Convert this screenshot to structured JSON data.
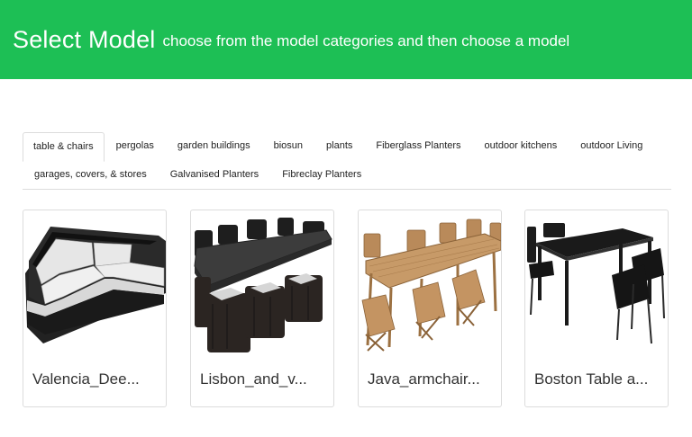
{
  "header": {
    "title": "Select Model",
    "subtitle": "choose from the model categories and then choose a model"
  },
  "tabs": {
    "active": "table & chairs",
    "row1": [
      "table & chairs",
      "pergolas",
      "garden buildings",
      "biosun",
      "plants",
      "Fiberglass Planters",
      "outdoor kitchens",
      "outdoor Living"
    ],
    "row2": [
      "garages, covers, & stores",
      "Galvanised Planters",
      "Fibreclay Planters"
    ]
  },
  "models": [
    {
      "label": "Valencia_Dee...",
      "icon": "corner-sofa-image"
    },
    {
      "label": "Lisbon_and_v...",
      "icon": "rattan-dining-set-image"
    },
    {
      "label": "Java_armchair...",
      "icon": "teak-dining-set-image"
    },
    {
      "label": "Boston Table a...",
      "icon": "black-table-chairs-image"
    }
  ],
  "colors": {
    "header_bg": "#1dbf55",
    "header_text": "#ffffff"
  }
}
